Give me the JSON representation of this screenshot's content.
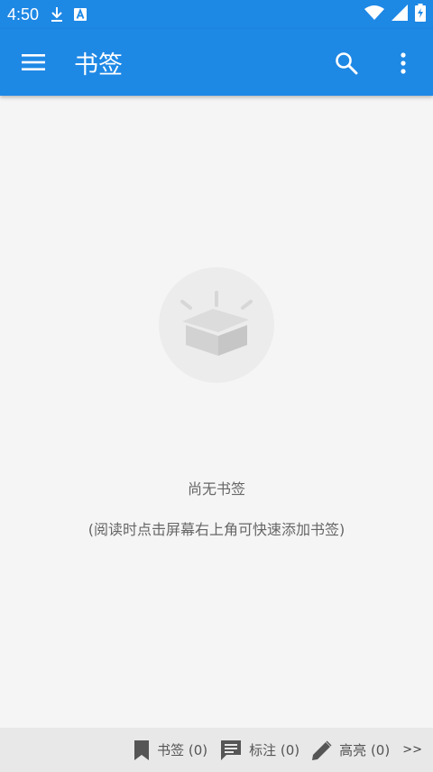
{
  "status_bar": {
    "time": "4:50",
    "icons_left": [
      "download-icon",
      "a-box-icon"
    ],
    "icons_right": [
      "wifi-icon",
      "signal-icon",
      "battery-charging-icon"
    ]
  },
  "app_bar": {
    "title": "书签",
    "background": "#1e88e5",
    "icons": [
      "menu-icon",
      "search-icon",
      "more-vert-icon"
    ]
  },
  "empty_state": {
    "icon": "empty-box-icon",
    "title": "尚无书签",
    "hint": "(阅读时点击屏幕右上角可快速添加书签)"
  },
  "bottom_bar": {
    "items": [
      {
        "icon": "bookmark-icon",
        "label": "书签 (0)"
      },
      {
        "icon": "comment-icon",
        "label": "标注 (0)"
      },
      {
        "icon": "pencil-icon",
        "label": "高亮 (0)"
      }
    ],
    "more_label": ">>"
  }
}
